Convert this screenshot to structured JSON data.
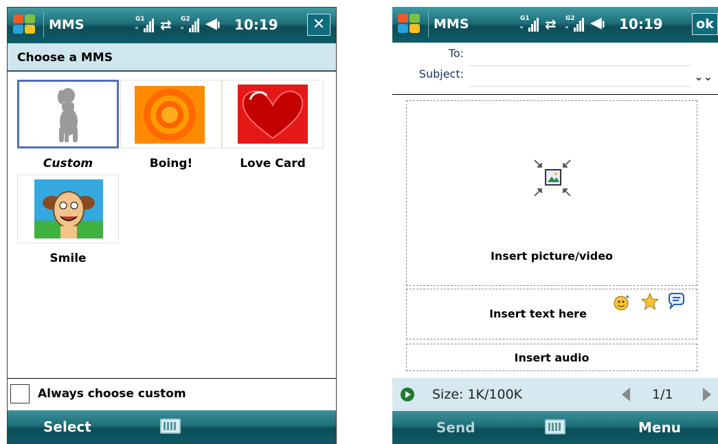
{
  "left": {
    "app_title": "MMS",
    "signal1": "G1",
    "signal2": "G2",
    "time": "10:19",
    "close_label": "✕",
    "header": "Choose a MMS",
    "templates": [
      {
        "label": "Custom",
        "icon": "dog-silhouette-icon"
      },
      {
        "label": "Boing!",
        "icon": "concentric-circles-icon"
      },
      {
        "label": "Love Card",
        "icon": "heart-icon"
      },
      {
        "label": "Smile",
        "icon": "cartoon-face-icon"
      }
    ],
    "checkbox_label": "Always choose custom",
    "softkey_left": "Select"
  },
  "right": {
    "app_title": "MMS",
    "signal1": "G1",
    "signal2": "G2",
    "time": "10:19",
    "ok_label": "ok",
    "to_label": "To:",
    "subject_label": "Subject:",
    "expand_icon": "double-chevron-down-icon",
    "insert_picture": "Insert picture/video",
    "insert_text": "Insert text here",
    "insert_audio": "Insert audio",
    "size_text": "Size: 1K/100K",
    "page_text": "1/1",
    "softkey_left": "Send",
    "softkey_right": "Menu"
  },
  "colors": {
    "title_bar": "#1d6f79",
    "selection": "#4b70b8",
    "header_band": "#cfe6ef"
  }
}
